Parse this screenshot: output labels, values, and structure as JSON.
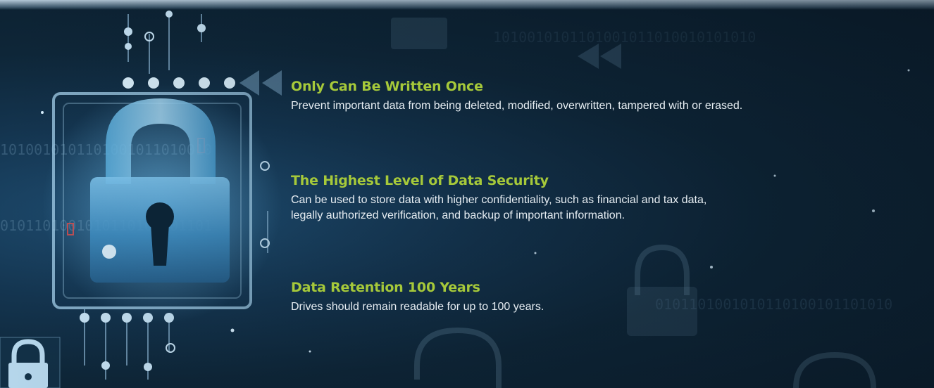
{
  "features": [
    {
      "title": "Only Can Be Written Once",
      "lines": [
        "Prevent important data from being deleted, modified, overwritten, tampered with or erased."
      ]
    },
    {
      "title": "The Highest Level of Data Security",
      "lines": [
        "Can be used to store data with higher confidentiality, such as financial and tax data,",
        "legally authorized verification, and backup of important information."
      ]
    },
    {
      "title": "Data Retention 100 Years",
      "lines": [
        "Drives should remain readable for up to 100 years."
      ]
    }
  ],
  "colors": {
    "title_accent": "#a6c93a",
    "body_text": "#e6edf2",
    "background": "#0e2638"
  },
  "icons": [
    "padlock-icon",
    "circuit-decoration",
    "small-lock-icon"
  ]
}
